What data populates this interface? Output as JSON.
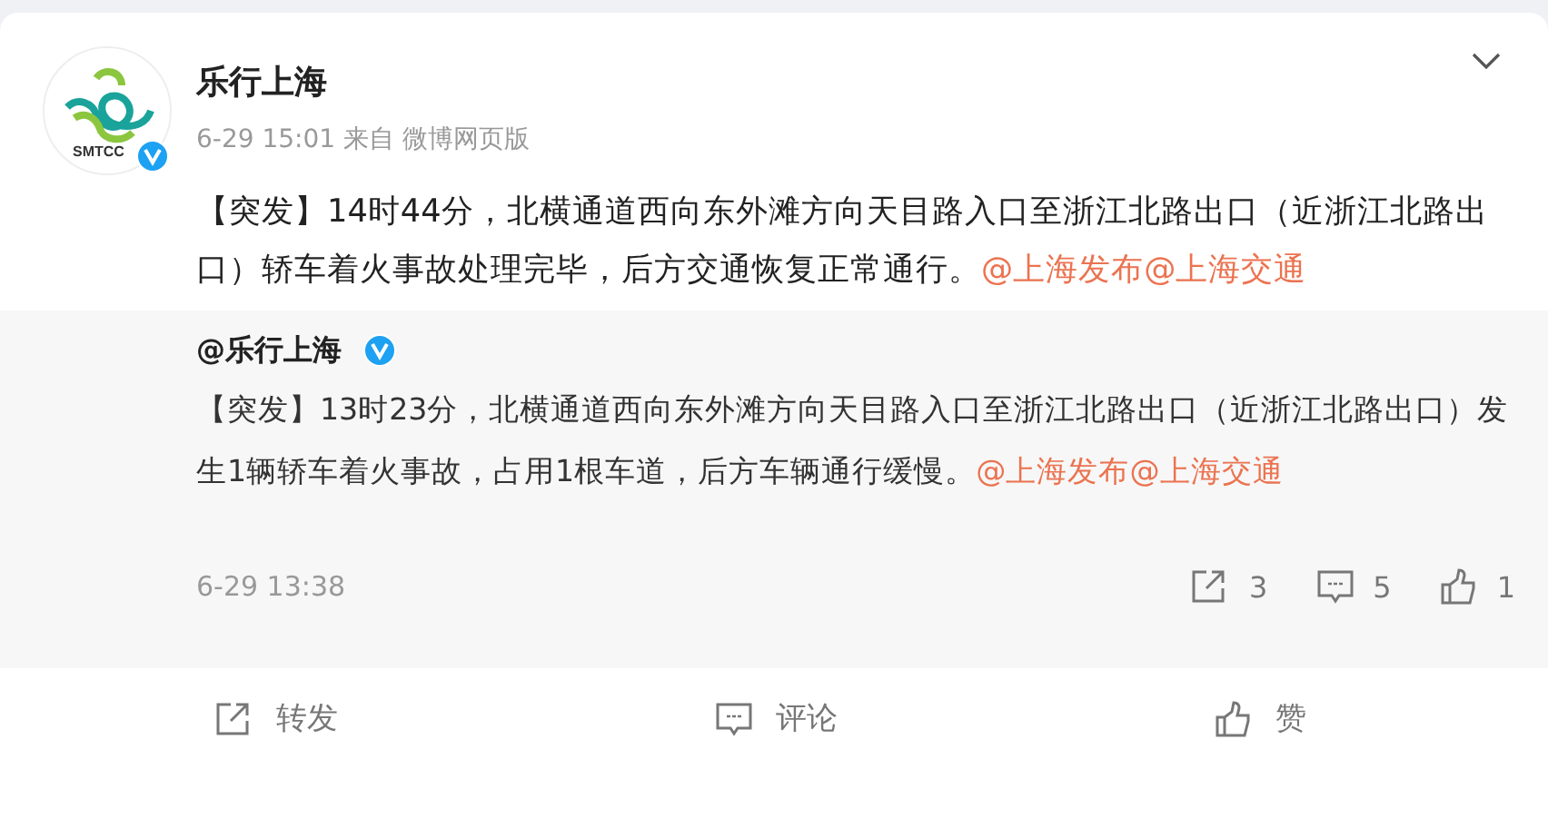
{
  "post": {
    "author": "乐行上海",
    "verified": true,
    "avatar_label": "SMTCC",
    "time": "6-29 15:01",
    "source": "来自 微博网页版",
    "text": "【突发】14时44分，北横通道西向东外滩方向天目路入口至浙江北路出口（近浙江北路出口）轿车着火事故处理完毕，后方交通恢复正常通行。",
    "mentions": [
      "@上海发布",
      "@上海交通"
    ]
  },
  "retweet": {
    "author": "@乐行上海",
    "verified": true,
    "text": "【突发】13时23分，北横通道西向东外滩方向天目路入口至浙江北路出口（近浙江北路出口）发生1辆轿车着火事故，占用1根车道，后方车辆通行缓慢。",
    "mentions": [
      "@上海发布",
      "@上海交通"
    ],
    "time": "6-29 13:38",
    "stats": [
      {
        "kind": "repost",
        "count": "3"
      },
      {
        "kind": "comment",
        "count": "5"
      },
      {
        "kind": "like",
        "count": "1"
      }
    ]
  },
  "actions": [
    {
      "kind": "repost",
      "label": "转发"
    },
    {
      "kind": "comment",
      "label": "评论"
    },
    {
      "kind": "like",
      "label": "赞"
    }
  ]
}
